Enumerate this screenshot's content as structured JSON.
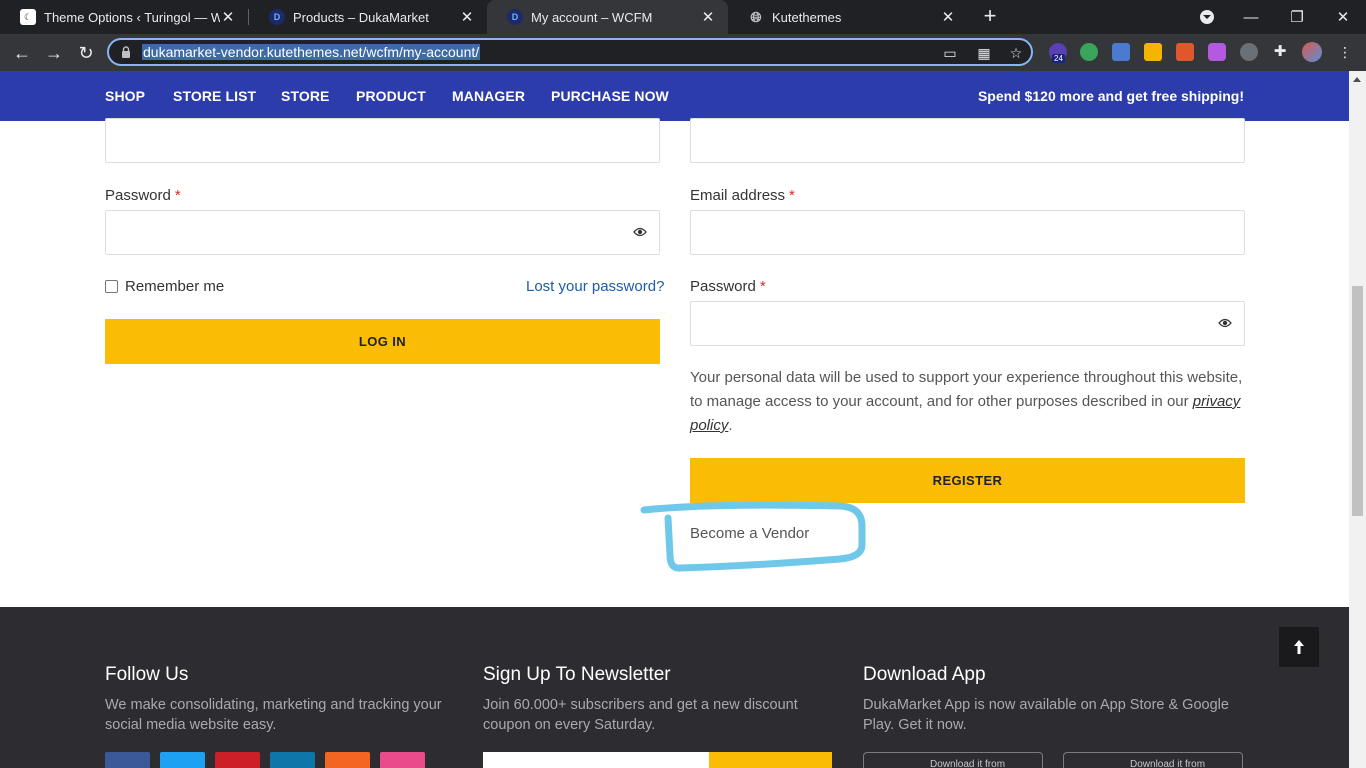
{
  "browser": {
    "tabs": [
      {
        "title": "Theme Options ‹ Turingol — Wo",
        "favicon": "document-icon"
      },
      {
        "title": "Products – DukaMarket",
        "favicon": "d-logo-icon"
      },
      {
        "title": "My account – WCFM",
        "favicon": "d-logo-icon",
        "active": true
      },
      {
        "title": "Kutethemes",
        "favicon": "globe-icon"
      }
    ],
    "url": "dukamarket-vendor.kutethemes.net/wcfm/my-account/",
    "extension_badge": "24",
    "accent": "#8ab4f8"
  },
  "site_nav": {
    "items": [
      "SHOP",
      "STORE LIST",
      "STORE",
      "PRODUCT",
      "MANAGER",
      "PURCHASE NOW"
    ],
    "promo": "Spend $120 more and get free shipping!",
    "color": "#2c3cab"
  },
  "login": {
    "password_label": "Password",
    "required_mark": "*",
    "remember_label": "Remember me",
    "lost_password": "Lost your password?",
    "login_button": "LOG IN"
  },
  "register": {
    "email_label": "Email address",
    "password_label": "Password",
    "required_mark": "*",
    "privacy_text": "Your personal data will be used to support your experience throughout this website, to manage access to your account, and for other purposes described in our ",
    "privacy_link": "privacy policy",
    "privacy_end": ".",
    "register_button": "REGISTER",
    "become_vendor": "Become a Vendor"
  },
  "footer": {
    "follow_title": "Follow Us",
    "follow_text": "We make consolidating, marketing and tracking your social media website easy.",
    "newsletter_title": "Sign Up To Newsletter",
    "newsletter_text": "Join 60.000+ subscribers and get a new discount coupon on every Saturday.",
    "app_title": "Download App",
    "app_text": "DukaMarket App is now available on App Store & Google Play. Get it now.",
    "store_button_1": "Download it from",
    "store_button_2": "Download it from",
    "social_colors": [
      "#3b5998",
      "#1da1f2",
      "#cb2027",
      "#0e76a8",
      "#f26522",
      "#ea4c89"
    ]
  },
  "accent_color": "#fbbc05"
}
